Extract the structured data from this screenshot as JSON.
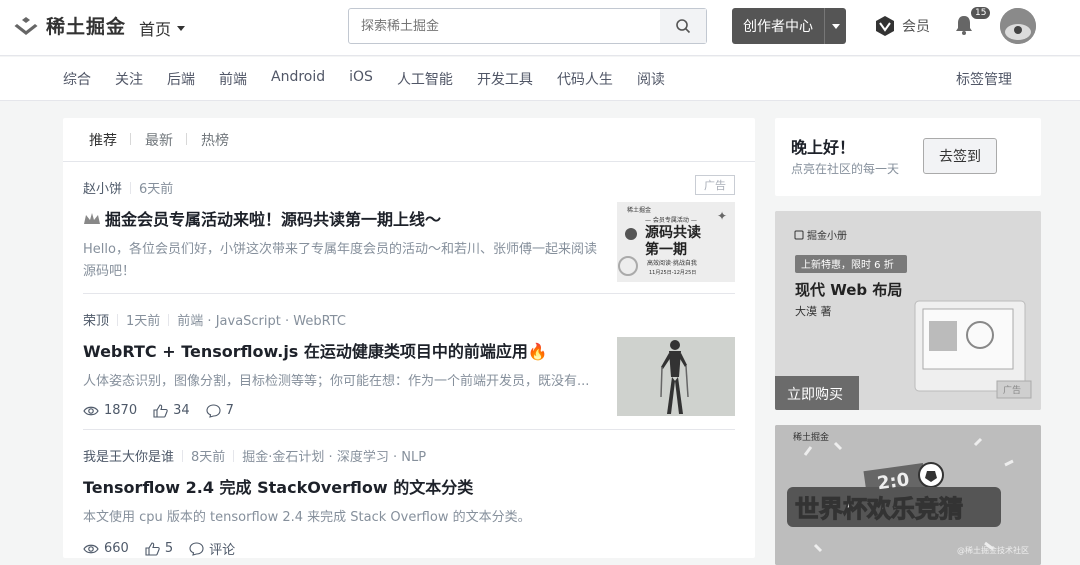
{
  "header": {
    "logo_text": "稀土掘金",
    "home_label": "首页",
    "search_placeholder": "探索稀土掘金",
    "creator_label": "创作者中心",
    "vip_label": "会员",
    "notification_count": "15"
  },
  "subnav": {
    "items": [
      "综合",
      "关注",
      "后端",
      "前端",
      "Android",
      "iOS",
      "人工智能",
      "开发工具",
      "代码人生",
      "阅读"
    ],
    "tag_manage": "标签管理"
  },
  "feed": {
    "tabs": [
      "推荐",
      "最新",
      "热榜"
    ],
    "articles": [
      {
        "author": "赵小饼",
        "time": "6天前",
        "ad_label": "广告",
        "title": "掘金会员专属活动来啦！源码共读第一期上线～",
        "desc_line1": "Hello，各位会员们好，小饼这次带来了专属年度会员的活动～和若川、张师傅一起来阅读",
        "desc_line2": "源码吧！",
        "thumb": {
          "brand": "稀土掘金",
          "line1": "— 会员专属活动 —",
          "line2": "源码共读",
          "line3": "第一期",
          "line4": "高效阅读·挑战自我",
          "dates": "11月25日-12月25日"
        }
      },
      {
        "author": "荣顶",
        "time": "1天前",
        "tags": "前端 · JavaScript · WebRTC",
        "title": "WebRTC + Tensorflow.js 在运动健康类项目中的前端应用🔥",
        "desc": "人体姿态识别，图像分割，目标检测等等；你可能在想：作为一个前端开发员，既没有...",
        "views": "1870",
        "likes": "34",
        "comments": "7"
      },
      {
        "author": "我是王大你是谁",
        "time": "8天前",
        "tags": "掘金·金石计划 · 深度学习 · NLP",
        "title": "Tensorflow 2.4 完成 StackOverflow 的文本分类",
        "desc": "本文使用 cpu 版本的 tensorflow 2.4 来完成 Stack Overflow 的文本分类。",
        "views": "660",
        "likes": "5",
        "comments": "评论"
      }
    ]
  },
  "sidebar": {
    "greeting": "晚上好！",
    "greeting_sub": "点亮在社区的每一天",
    "signin_label": "去签到",
    "ad1": {
      "brand": "掘金小册",
      "promo": "上新特惠，限时 6 折",
      "title": "现代 Web 布局",
      "author": "大漠 著",
      "buy": "立即购买",
      "ad": "广告"
    },
    "ad2": {
      "brand": "稀土掘金",
      "title": "世界杯欢乐竞猜",
      "score": "2:0",
      "watermark": "@稀土掘金技术社区"
    }
  }
}
